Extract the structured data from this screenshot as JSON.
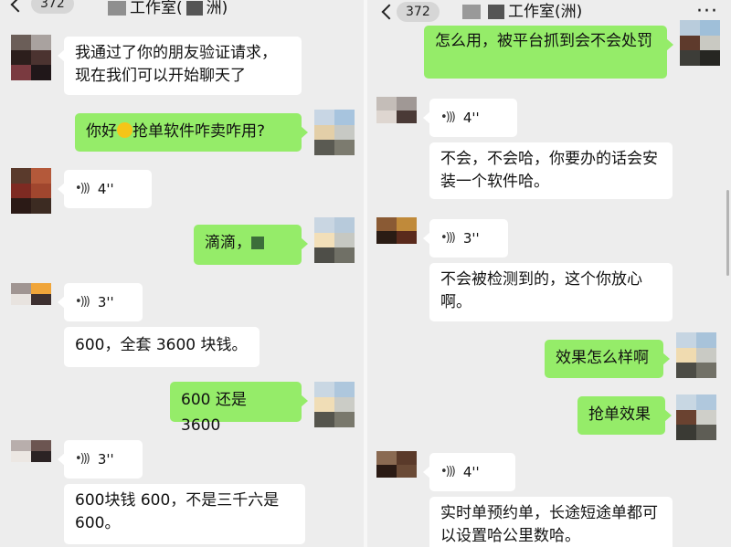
{
  "left": {
    "header": {
      "count": "372",
      "title": "工作室(",
      "title_tail": "洲)"
    },
    "messages": [
      {
        "id": "m1",
        "side": "in",
        "text": "我通过了你的朋友验证请求，现在我们可以开始聊天了"
      },
      {
        "id": "m2",
        "side": "out",
        "text_a": "你好",
        "text_b": "抢单软件咋卖咋用?"
      },
      {
        "id": "m3",
        "side": "in",
        "voice": "4''"
      },
      {
        "id": "m4",
        "side": "out",
        "text": "滴滴，"
      },
      {
        "id": "m5",
        "side": "in",
        "voice": "3''"
      },
      {
        "id": "m6",
        "side": "in",
        "text": "600，全套 3600 块钱。"
      },
      {
        "id": "m7",
        "side": "out",
        "text": "600 还是 3600"
      },
      {
        "id": "m8",
        "side": "in",
        "voice": "3''"
      },
      {
        "id": "m9",
        "side": "in",
        "text": "600块钱 600，不是三千六是 600。"
      }
    ]
  },
  "right": {
    "header": {
      "count": "372",
      "title": "工作室(",
      "title_tail": "洲)"
    },
    "messages": [
      {
        "id": "r1",
        "side": "out",
        "text": "怎么用，被平台抓到会不会处罚"
      },
      {
        "id": "r2",
        "side": "in",
        "voice": "4''"
      },
      {
        "id": "r3",
        "side": "in",
        "text": "不会，不会哈，你要办的话会安装一个软件哈。"
      },
      {
        "id": "r4",
        "side": "in",
        "voice": "3''"
      },
      {
        "id": "r5",
        "side": "in",
        "text": "不会被检测到的，这个你放心啊。"
      },
      {
        "id": "r6",
        "side": "out",
        "text": "效果怎么样啊"
      },
      {
        "id": "r7",
        "side": "out",
        "text": "抢单效果"
      },
      {
        "id": "r8",
        "side": "in",
        "voice": "4''"
      },
      {
        "id": "r9",
        "side": "in",
        "text": "实时单预约单，长途短途单都可以设置哈公里数哈。"
      }
    ]
  },
  "icons": {
    "back": "chevron-left-icon",
    "more": "more-dots-icon",
    "voice": "voice-wave-icon",
    "emoji": "smile-emoji-icon"
  },
  "colors": {
    "background": "#ededed",
    "incoming_bubble": "#ffffff",
    "outgoing_bubble": "#95ec69"
  }
}
